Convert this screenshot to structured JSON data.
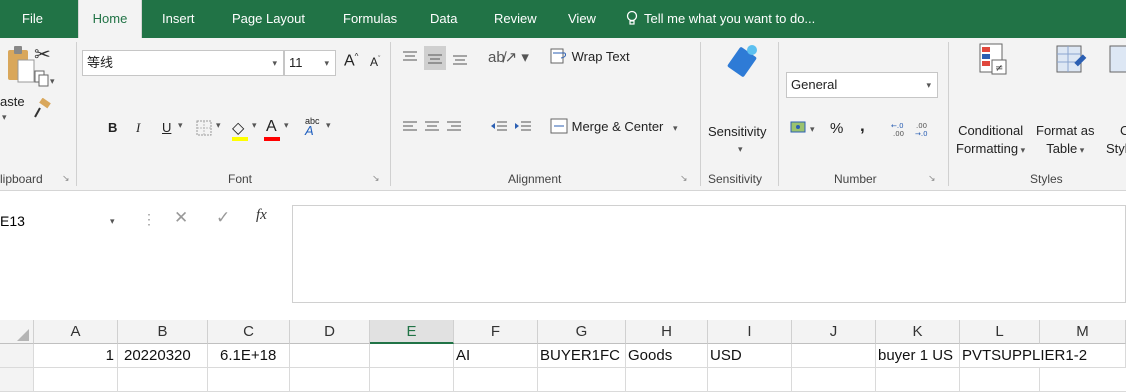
{
  "tabs": {
    "file": "File",
    "home": "Home",
    "insert": "Insert",
    "page_layout": "Page Layout",
    "formulas": "Formulas",
    "data": "Data",
    "review": "Review",
    "view": "View",
    "tell_me": "Tell me what you want to do..."
  },
  "ribbon": {
    "clipboard": {
      "paste": "aste",
      "label": "lipboard"
    },
    "font": {
      "name": "等线",
      "size": "11",
      "bold": "B",
      "italic": "I",
      "underline": "U",
      "grow": "A",
      "shrink": "A",
      "font_color_glyph": "A",
      "phonetic": "abc",
      "label": "Font"
    },
    "alignment": {
      "wrap_text": "Wrap Text",
      "merge_center": "Merge & Center",
      "label": "Alignment"
    },
    "sensitivity": {
      "button": "Sensitivity",
      "label": "Sensitivity"
    },
    "number": {
      "format": "General",
      "percent": "%",
      "comma": ",",
      "label": "Number"
    },
    "styles": {
      "conditional_1": "Conditional",
      "conditional_2": "Formatting",
      "format_as_1": "Format as",
      "format_as_2": "Table",
      "cell_styles_1": "Ce",
      "cell_styles_2": "Style",
      "label": "Styles"
    },
    "colors": {
      "fill": "#ffff00",
      "font": "#ff0000"
    }
  },
  "formula_bar": {
    "name_box": "E13",
    "fx": "fx",
    "content": ""
  },
  "sheet": {
    "columns": [
      "A",
      "B",
      "C",
      "D",
      "E",
      "F",
      "G",
      "H",
      "I",
      "J",
      "K",
      "L",
      "M"
    ],
    "selected_column": "E",
    "row1": {
      "A": "1",
      "B": "20220320",
      "C": "6.1E+18",
      "D": "",
      "E": "",
      "F": "AI",
      "G": "BUYER1FC",
      "H": "Goods",
      "I": "USD",
      "J": "",
      "K": "buyer 1 US",
      "L": "PVTSUPPLIER1-2",
      "M": ""
    }
  }
}
